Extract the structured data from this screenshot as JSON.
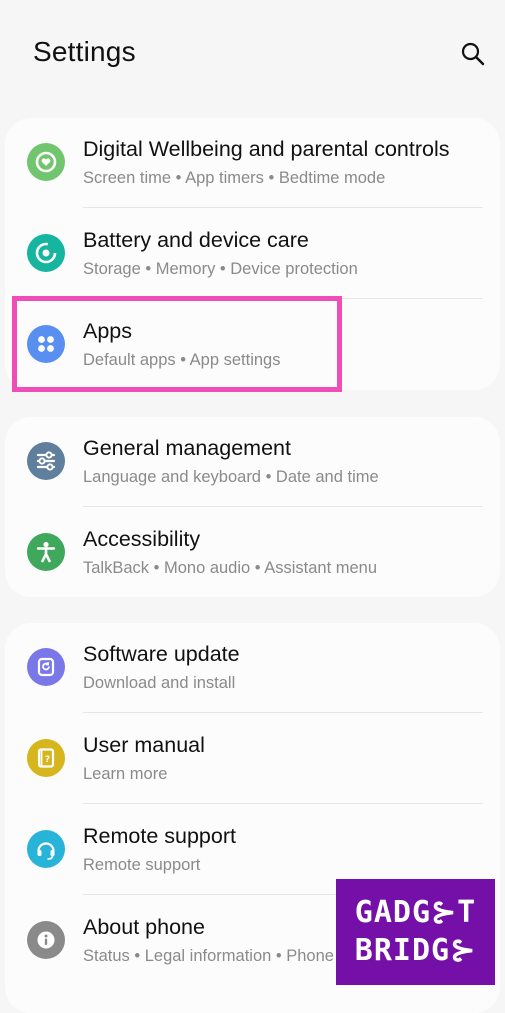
{
  "header": {
    "title": "Settings",
    "search_icon": "search-icon"
  },
  "cards": [
    {
      "items": [
        {
          "title": "Digital Wellbeing and parental controls",
          "subtitle": "Screen time  •  App timers  •  Bedtime mode",
          "icon": "wellbeing-icon",
          "color": "#72c56f"
        },
        {
          "title": "Battery and device care",
          "subtitle": "Storage  •  Memory  •  Device protection",
          "icon": "device-care-icon",
          "color": "#15b5a0"
        },
        {
          "title": "Apps",
          "subtitle": "Default apps  •  App settings",
          "icon": "apps-icon",
          "color": "#5a8ff2"
        }
      ]
    },
    {
      "items": [
        {
          "title": "General management",
          "subtitle": "Language and keyboard  •  Date and time",
          "icon": "sliders-icon",
          "color": "#5f7f9c"
        },
        {
          "title": "Accessibility",
          "subtitle": "TalkBack  •  Mono audio  •  Assistant menu",
          "icon": "accessibility-icon",
          "color": "#3fa85c"
        }
      ]
    },
    {
      "items": [
        {
          "title": "Software update",
          "subtitle": "Download and install",
          "icon": "software-update-icon",
          "color": "#7a78e8"
        },
        {
          "title": "User manual",
          "subtitle": "Learn more",
          "icon": "user-manual-icon",
          "color": "#d6b51d"
        },
        {
          "title": "Remote support",
          "subtitle": "Remote support",
          "icon": "headset-icon",
          "color": "#27b4d8"
        },
        {
          "title": "About phone",
          "subtitle": "Status  •  Legal information  •  Phone name",
          "icon": "info-icon",
          "color": "#8a8a8a"
        }
      ]
    }
  ],
  "highlight_color": "#ee4eb5",
  "watermark": {
    "line1": "GADG⊱T",
    "line2": "BRIDG⊱",
    "color": "#7410a8"
  }
}
